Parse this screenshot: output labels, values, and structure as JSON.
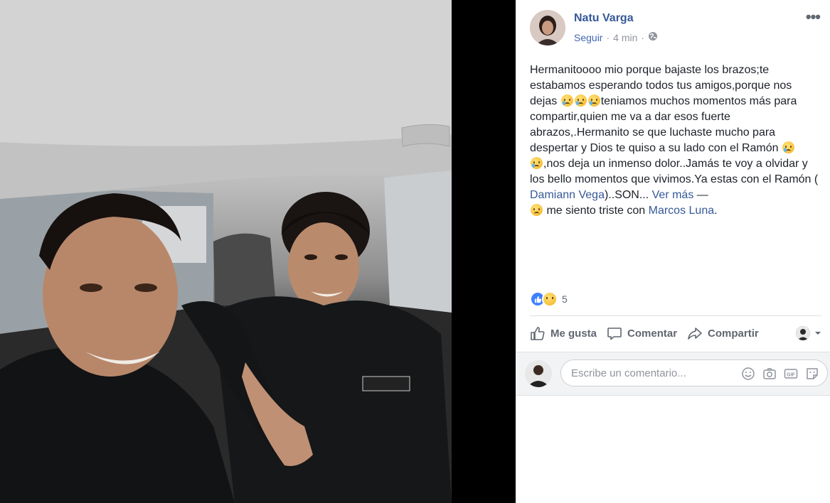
{
  "post": {
    "author": "Natu Varga",
    "follow_label": "Seguir",
    "separator": "·",
    "time": "4 min",
    "more_label": "•••",
    "text": {
      "part1": "Hermanitoooo mio porque bajaste los brazos;te estabamos esperando todos tus amigos,porque nos dejas ",
      "part2": "teniamos muchos momentos más para compartir,quien me va a dar esos fuerte abrazos,.Hermanito se que luchaste mucho para despertar y Dios te quiso a su lado con el Ramón ",
      "part3": ",nos deja un inmenso dolor..Jamás te voy a olvidar y los bello momentos que vivimos.Ya estas con el Ramón ( ",
      "tagged_person": "Damiann Vega",
      "part4": ")..SON... ",
      "see_more": "Ver más",
      "dash": " — ",
      "feeling": " me siento triste con ",
      "with_person": "Marcos Luna",
      "end": "."
    },
    "reaction_count": "5",
    "actions": {
      "like": "Me gusta",
      "comment": "Comentar",
      "share": "Compartir"
    },
    "comment_placeholder": "Escribe un comentario...",
    "colors": {
      "link": "#365899",
      "like_blue": "#4080ff",
      "muted": "#90949c"
    }
  }
}
